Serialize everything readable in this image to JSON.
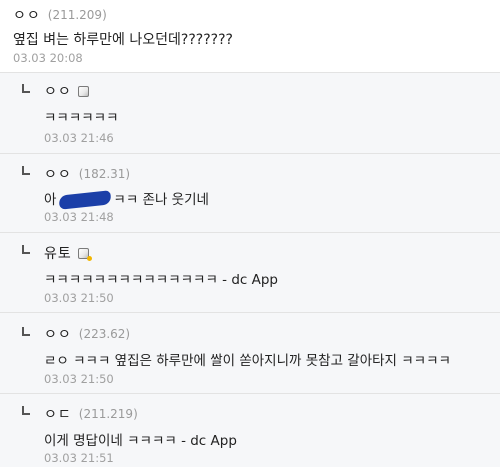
{
  "comments": [
    {
      "nick": "ㅇㅇ",
      "ip": "(211.209)",
      "text": "옆집 벼는 하루만에 나오던데???????",
      "time": "03.03 20:08"
    },
    {
      "nick": "ㅇㅇ",
      "ip": "",
      "text": "ㅋㅋㅋㅋㅋㅋ",
      "time": "03.03 21:46",
      "memo_icon": "memo-icon"
    },
    {
      "nick": "ㅇㅇ",
      "ip": "(182.31)",
      "text_before": "아",
      "text_after": "ㅋㅋ 존나 웃기네",
      "time": "03.03 21:48",
      "redaction": "redaction-scribble"
    },
    {
      "nick": "유토",
      "ip": "",
      "text": "ㅋㅋㅋㅋㅋㅋㅋㅋㅋㅋㅋㅋㅋㅋ - dc App",
      "time": "03.03 21:50",
      "memo_icon": "memo-fixed-icon"
    },
    {
      "nick": "ㅇㅇ",
      "ip": "(223.62)",
      "text": "ㄹㅇ ㅋㅋㅋ 옆집은 하루만에 쌀이 쏟아지니까 못참고 갈아타지 ㅋㅋㅋㅋ",
      "time": "03.03 21:50"
    },
    {
      "nick": "ㅇㄷ",
      "ip": "(211.219)",
      "text": "이게 명답이네 ㅋㅋㅋㅋ - dc App",
      "time": "03.03 21:51"
    }
  ],
  "colors": {
    "reply_background": "#f6f7f9",
    "divider": "#e3e3e3",
    "meta_text": "#9a9a9a",
    "redaction_scribble": "#1b3fa8"
  }
}
